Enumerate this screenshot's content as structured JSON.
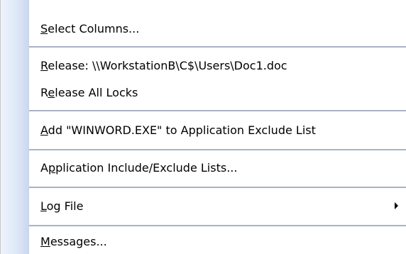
{
  "menu": {
    "items": [
      {
        "mnemonic": "S",
        "rest": "elect Columns...",
        "label": "Select Columns..."
      },
      {
        "mnemonic": "R",
        "rest": "elease: \\\\WorkstationB\\C$\\Users\\Doc1.doc",
        "label": "Release: \\\\WorkstationB\\C$\\Users\\Doc1.doc"
      },
      {
        "prefix": "R",
        "mnemonic": "e",
        "rest": "lease All Locks",
        "label": "Release All Locks"
      },
      {
        "mnemonic": "A",
        "rest": "dd \"WINWORD.EXE\" to Application Exclude List",
        "label": "Add \"WINWORD.EXE\" to Application Exclude List"
      },
      {
        "prefix": "A",
        "mnemonic": "p",
        "rest": "plication Include/Exclude Lists...",
        "label": "Application Include/Exclude Lists..."
      },
      {
        "mnemonic": "L",
        "rest": "og File",
        "label": "Log File",
        "has_submenu": true
      },
      {
        "mnemonic": "M",
        "rest": "essages...",
        "label": "Messages..."
      }
    ],
    "icons": {
      "submenu_arrow": "submenu-arrow-icon"
    },
    "colors": {
      "gutter": "#dfe8f7",
      "separator": "#a9b3c4",
      "background": "#ffffff"
    }
  }
}
